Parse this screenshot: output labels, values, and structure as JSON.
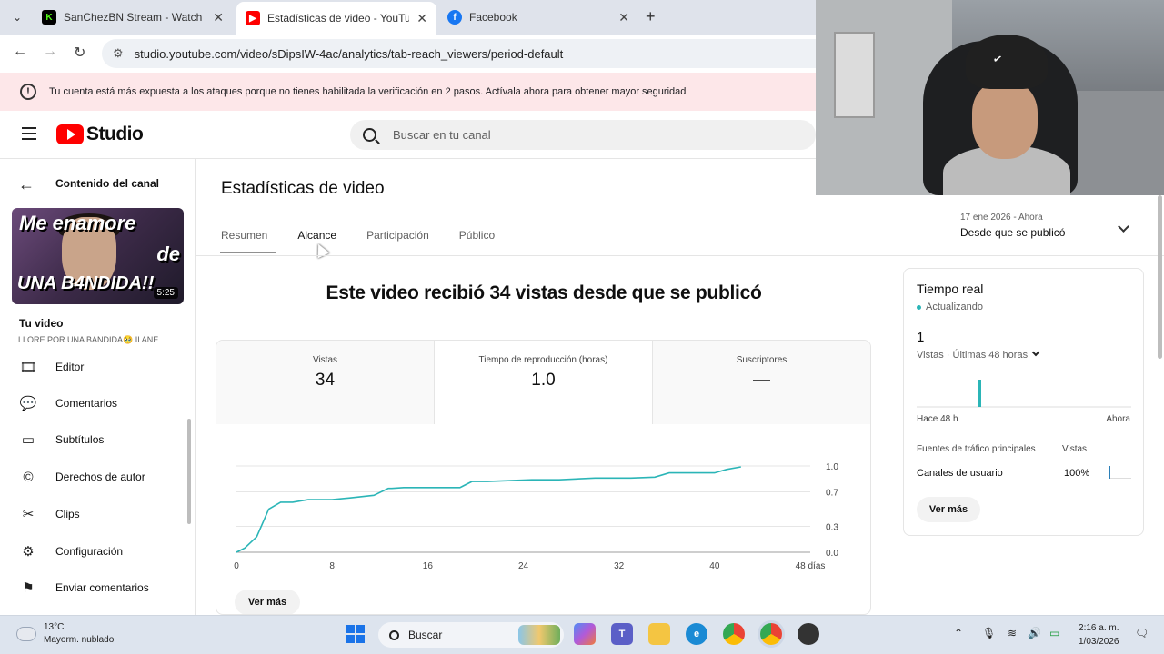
{
  "browser": {
    "tabs": [
      {
        "title": "SanChezBN Stream - Watch Live",
        "favicon": "kick-icon",
        "color": "#53fc18"
      },
      {
        "title": "Estadísticas de video - YouTube Studio",
        "favicon": "youtube-icon",
        "color": "#ff0000"
      },
      {
        "title": "Facebook",
        "favicon": "facebook-icon",
        "color": "#1877f2"
      }
    ],
    "url": "studio.youtube.com/video/sDipsIW-4ac/analytics/tab-reach_viewers/period-default"
  },
  "banner": {
    "text": "Tu cuenta está más expuesta a los ataques porque no tienes habilitada la verificación en 2 pasos. Actívala ahora para obtener mayor seguridad"
  },
  "header": {
    "logo_text": "Studio",
    "search_placeholder": "Buscar en tu canal"
  },
  "sidebar": {
    "back_label": "Contenido del canal",
    "thumbnail": {
      "line1": "Me enamore",
      "line2": "de",
      "line3": "UNA B4NDIDA!!",
      "duration": "5:25"
    },
    "your_video_label": "Tu video",
    "video_title": "LLORE POR UNA BANDIDA🥹 II ANE...",
    "items": [
      {
        "label": "Editor",
        "icon": "film-icon"
      },
      {
        "label": "Comentarios",
        "icon": "comment-icon"
      },
      {
        "label": "Subtítulos",
        "icon": "subtitles-icon"
      },
      {
        "label": "Derechos de autor",
        "icon": "copyright-icon"
      },
      {
        "label": "Clips",
        "icon": "scissors-icon"
      },
      {
        "label": "Configuración",
        "icon": "gear-icon"
      },
      {
        "label": "Enviar comentarios",
        "icon": "feedback-icon"
      }
    ]
  },
  "main": {
    "title": "Estadísticas de video",
    "tabs": [
      "Resumen",
      "Alcance",
      "Participación",
      "Público"
    ],
    "period": {
      "range": "17 ene 2026 - Ahora",
      "label": "Desde que se publicó"
    },
    "headline": "Este video recibió 34 vistas desde que se publicó",
    "stats": [
      {
        "label": "Vistas",
        "value": "34"
      },
      {
        "label": "Tiempo de reproducción (horas)",
        "value": "1.0"
      },
      {
        "label": "Suscriptores",
        "value": "—"
      }
    ],
    "see_more": "Ver más"
  },
  "chart_data": {
    "type": "line",
    "title": "",
    "xlabel": "",
    "ylabel": "",
    "x_ticks": [
      "0",
      "8",
      "16",
      "24",
      "32",
      "40",
      "48 días"
    ],
    "y_ticks": [
      "1.0",
      "0.7",
      "0.3",
      "0.0"
    ],
    "xlim": [
      0,
      48
    ],
    "ylim": [
      0,
      1.0
    ],
    "color": "#2bb5b7",
    "series": [
      {
        "x": [
          0,
          0.7,
          1.7,
          2.7,
          3.7,
          4.7,
          6,
          8,
          9.5,
          11.5,
          12.7,
          13,
          14,
          16,
          18.7,
          19.7,
          21,
          24.7,
          27,
          30,
          33,
          35,
          36.2,
          40,
          41,
          42.2
        ],
        "y": [
          0.0,
          0.05,
          0.18,
          0.5,
          0.58,
          0.58,
          0.61,
          0.61,
          0.63,
          0.66,
          0.74,
          0.74,
          0.75,
          0.75,
          0.75,
          0.82,
          0.82,
          0.84,
          0.84,
          0.86,
          0.86,
          0.87,
          0.92,
          0.92,
          0.96,
          0.99
        ]
      }
    ]
  },
  "realtime": {
    "title": "Tiempo real",
    "status": "Actualizando",
    "count": "1",
    "subtitle": "Vistas · Últimas 48 horas",
    "axis_start": "Hace 48 h",
    "axis_end": "Ahora",
    "table_header_source": "Fuentes de tráfico principales",
    "table_header_views": "Vistas",
    "rows": [
      {
        "source": "Canales de usuario",
        "views": "100%"
      }
    ],
    "see_more": "Ver más"
  },
  "taskbar": {
    "weather_temp": "13°C",
    "weather_desc": "Mayorm. nublado",
    "search_label": "Buscar",
    "time": "2:16 a. m.",
    "date": "1/03/2026"
  }
}
